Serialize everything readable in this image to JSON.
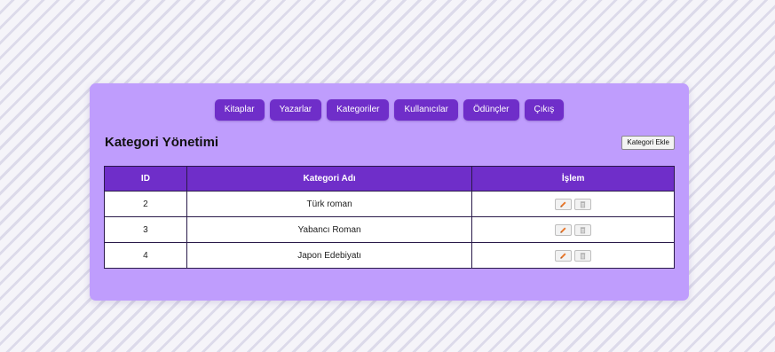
{
  "nav": {
    "items": [
      {
        "label": "Kitaplar"
      },
      {
        "label": "Yazarlar"
      },
      {
        "label": "Kategoriler"
      },
      {
        "label": "Kullanıcılar"
      },
      {
        "label": "Ödünçler"
      },
      {
        "label": "Çıkış"
      }
    ]
  },
  "page": {
    "title": "Kategori Yönetimi",
    "add_button": "Kategori Ekle"
  },
  "table": {
    "headers": {
      "id": "ID",
      "name": "Kategori Adı",
      "actions": "İşlem"
    },
    "rows": [
      {
        "id": "2",
        "name": "Türk roman",
        "edit_icon": "pencil-icon",
        "delete_icon": "trash-icon"
      },
      {
        "id": "3",
        "name": "Yabancı Roman",
        "edit_icon": "pencil-icon",
        "delete_icon": "trash-icon"
      },
      {
        "id": "4",
        "name": "Japon Edebiyatı",
        "edit_icon": "pencil-icon",
        "delete_icon": "trash-icon"
      }
    ]
  },
  "colors": {
    "panel": "#bf9dfd",
    "accent": "#6f2ec9",
    "edit_icon": "#e8762a"
  }
}
